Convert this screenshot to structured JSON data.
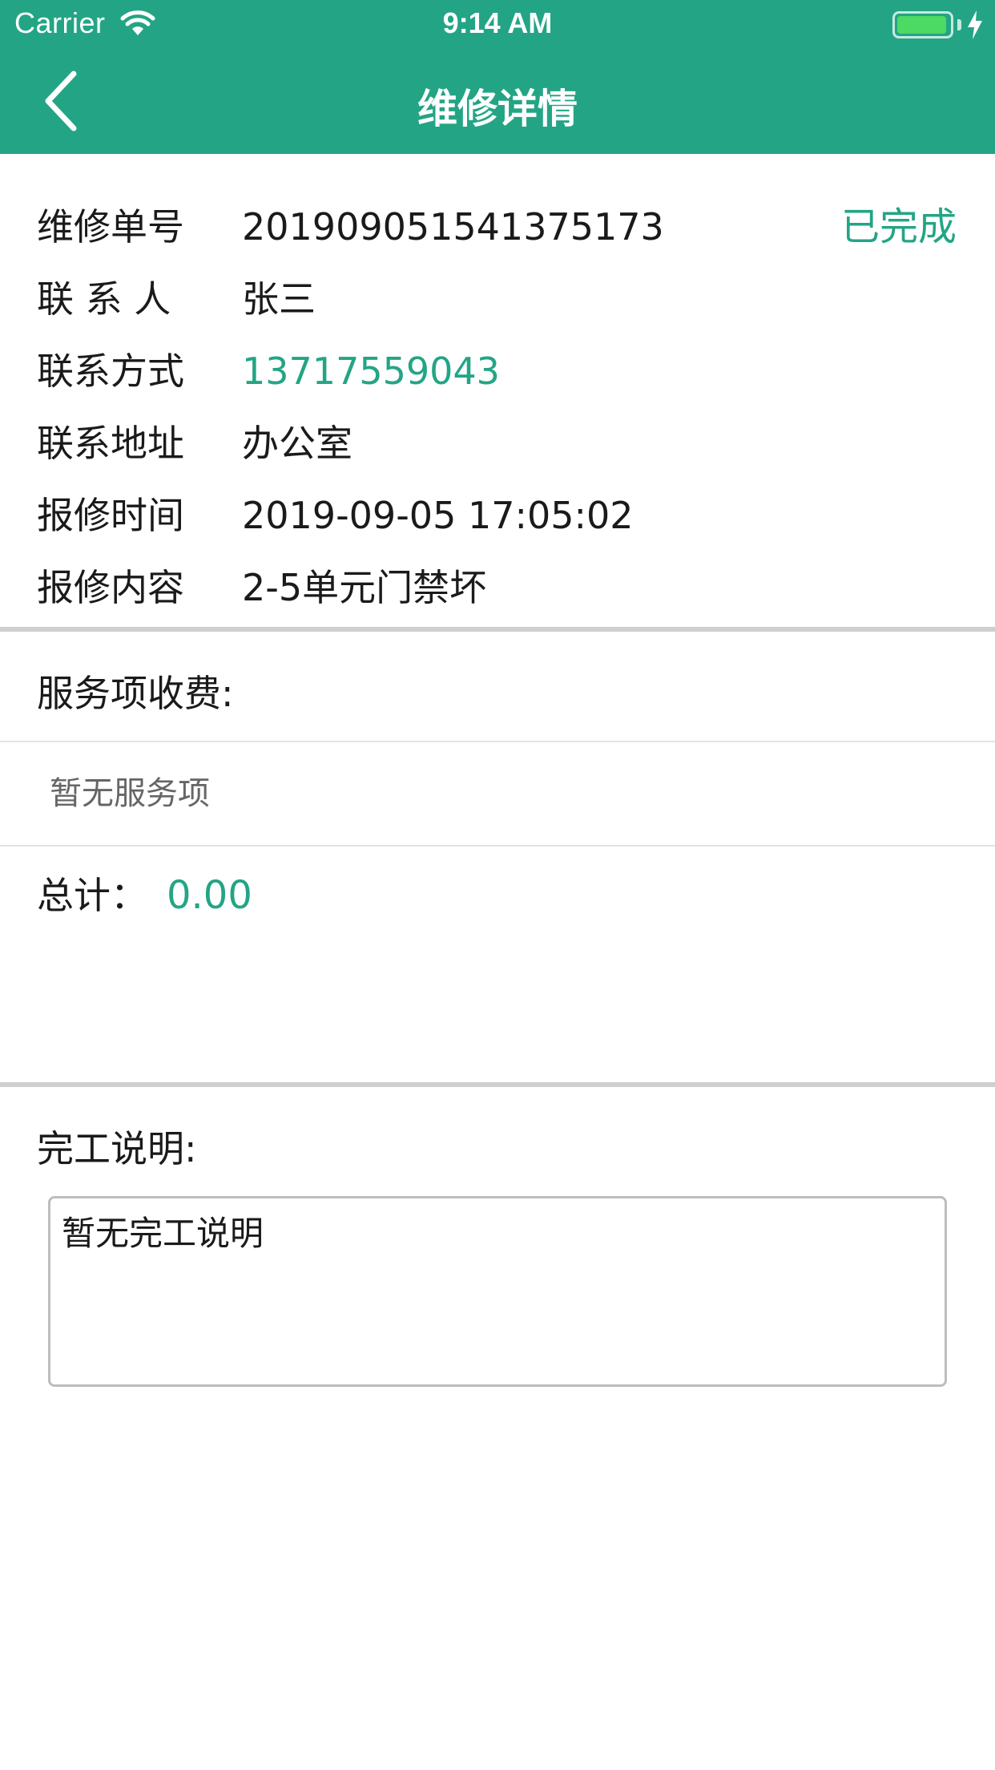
{
  "status_bar": {
    "carrier": "Carrier",
    "time": "9:14 AM",
    "battery_level": 0.95
  },
  "nav": {
    "title": "维修详情"
  },
  "details": {
    "order_no_label": "维修单号",
    "order_no": "201909051541375173",
    "status": "已完成",
    "contact_label": "联 系 人",
    "contact": "张三",
    "phone_label": "联系方式",
    "phone": "13717559043",
    "address_label": "联系地址",
    "address": "办公室",
    "time_label": "报修时间",
    "time": "2019-09-05 17:05:02",
    "content_label": "报修内容",
    "content": "2-5单元门禁坏"
  },
  "service": {
    "title": "服务项收费:",
    "empty_text": "暂无服务项",
    "total_label": "总计：",
    "total_value": "0.00"
  },
  "completion": {
    "title": "完工说明:",
    "text": "暂无完工说明"
  },
  "colors": {
    "brand": "#23a585",
    "divider": "#cfcfcf"
  }
}
